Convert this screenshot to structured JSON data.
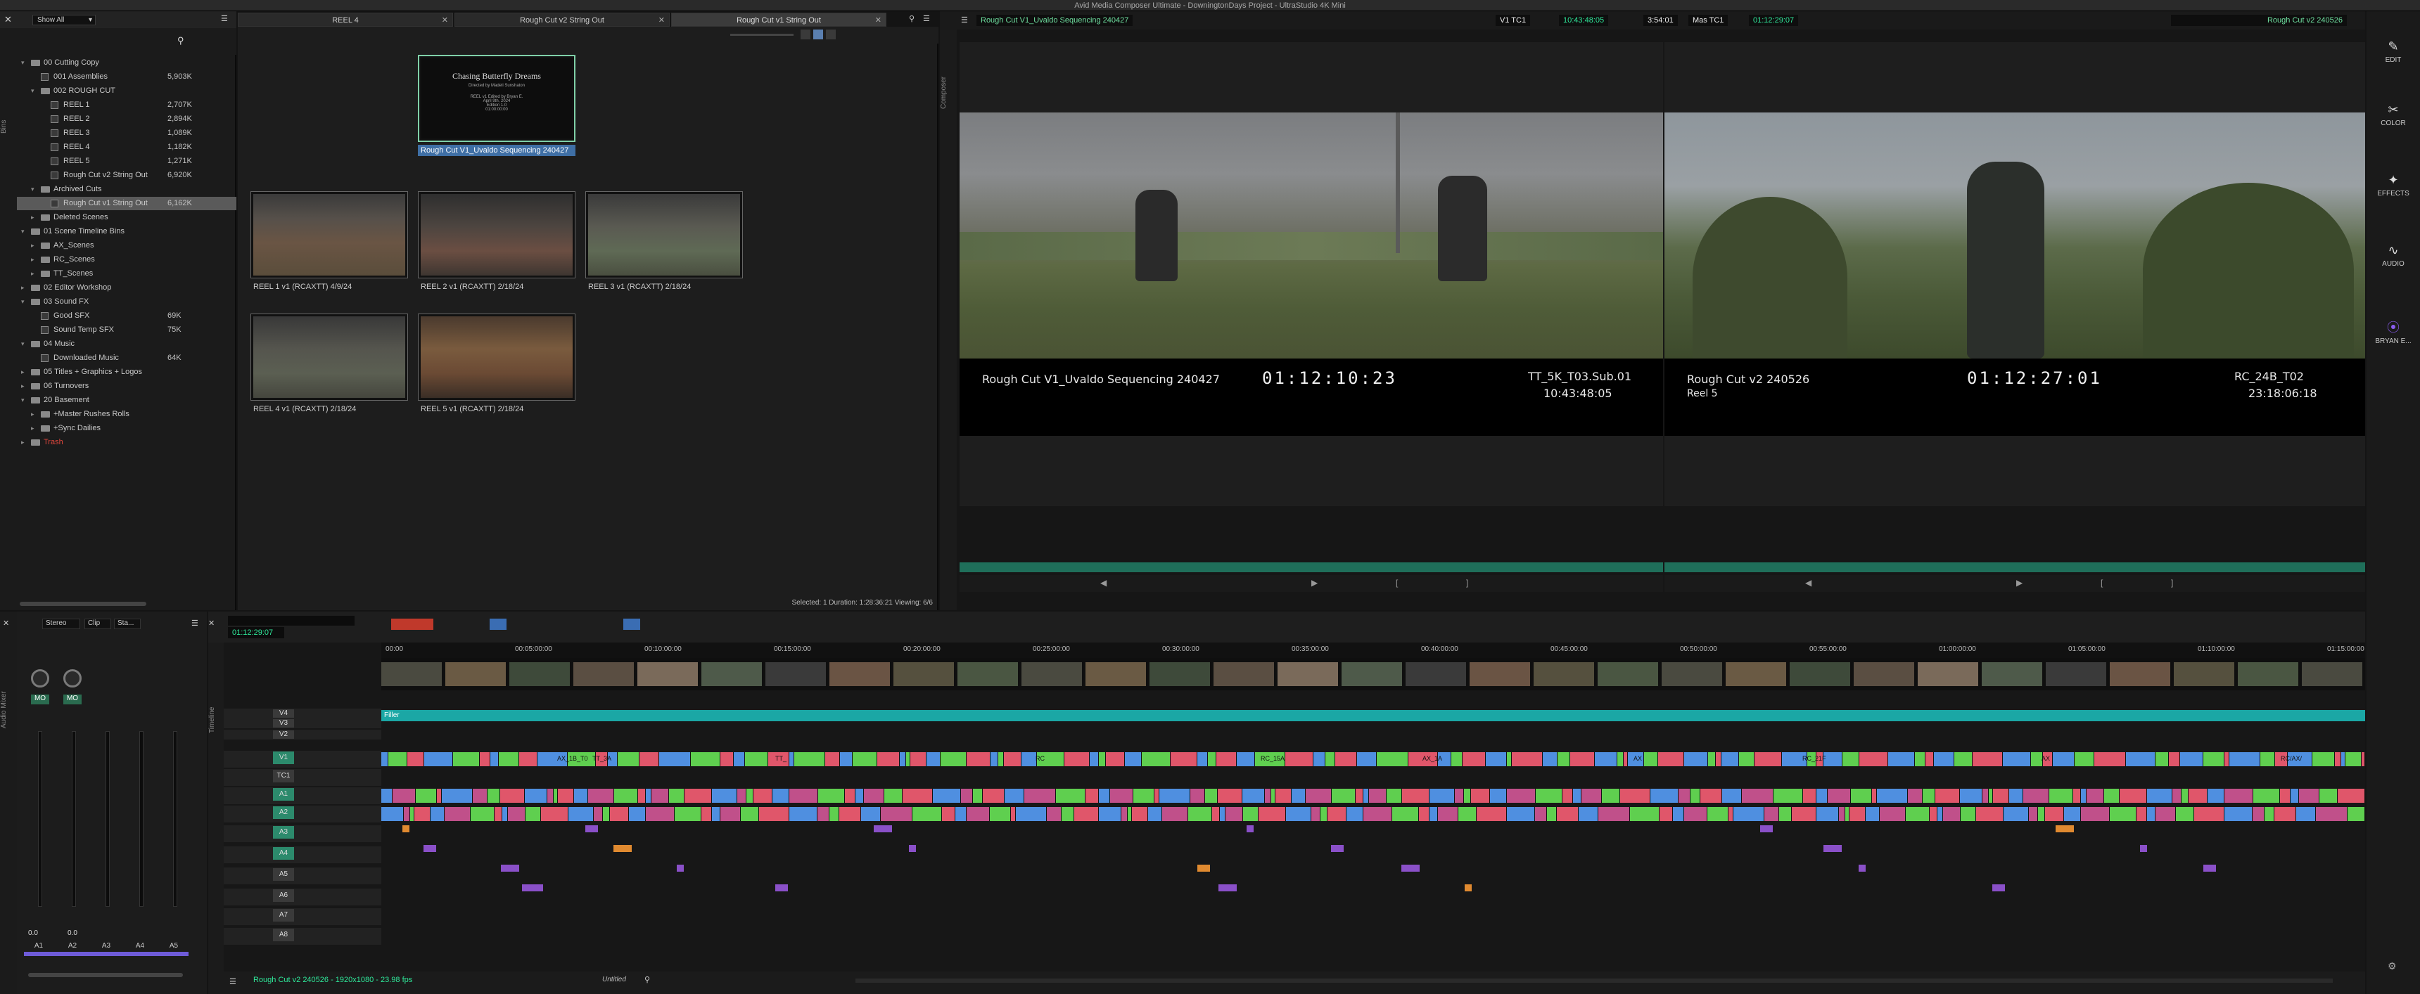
{
  "window": {
    "title": "Avid Media Composer Ultimate - DowningtonDays Project - UltraStudio 4K Mini"
  },
  "bins": {
    "show_all": "Show All",
    "tabs": [
      "Bins"
    ],
    "tree": [
      {
        "depth": 0,
        "open": true,
        "type": "folder",
        "label": "00 Cutting Copy",
        "size": ""
      },
      {
        "depth": 1,
        "open": false,
        "type": "bin",
        "label": "001 Assemblies",
        "size": "5,903K"
      },
      {
        "depth": 1,
        "open": true,
        "type": "folder",
        "label": "002 ROUGH CUT",
        "size": ""
      },
      {
        "depth": 2,
        "open": false,
        "type": "bin",
        "label": "REEL 1",
        "size": "2,707K"
      },
      {
        "depth": 2,
        "open": false,
        "type": "bin",
        "label": "REEL 2",
        "size": "2,894K"
      },
      {
        "depth": 2,
        "open": false,
        "type": "bin",
        "label": "REEL 3",
        "size": "1,089K"
      },
      {
        "depth": 2,
        "open": false,
        "type": "bin",
        "label": "REEL 4",
        "size": "1,182K"
      },
      {
        "depth": 2,
        "open": false,
        "type": "bin",
        "label": "REEL 5",
        "size": "1,271K"
      },
      {
        "depth": 2,
        "open": false,
        "type": "bin",
        "label": "Rough Cut v2 String Out",
        "size": "6,920K"
      },
      {
        "depth": 1,
        "open": true,
        "type": "folder",
        "label": "Archived Cuts",
        "size": ""
      },
      {
        "depth": 2,
        "open": false,
        "type": "bin",
        "label": "Rough Cut v1 String Out",
        "size": "6,162K",
        "selected": true
      },
      {
        "depth": 1,
        "open": false,
        "type": "folder",
        "label": "Deleted Scenes",
        "size": ""
      },
      {
        "depth": 0,
        "open": true,
        "type": "folder",
        "label": "01 Scene Timeline Bins",
        "size": ""
      },
      {
        "depth": 1,
        "open": false,
        "type": "folder",
        "label": "AX_Scenes",
        "size": ""
      },
      {
        "depth": 1,
        "open": false,
        "type": "folder",
        "label": "RC_Scenes",
        "size": ""
      },
      {
        "depth": 1,
        "open": false,
        "type": "folder",
        "label": "TT_Scenes",
        "size": ""
      },
      {
        "depth": 0,
        "open": false,
        "type": "folder",
        "label": "02 Editor Workshop",
        "size": ""
      },
      {
        "depth": 0,
        "open": true,
        "type": "folder",
        "label": "03 Sound FX",
        "size": ""
      },
      {
        "depth": 1,
        "open": false,
        "type": "bin",
        "label": "Good SFX",
        "size": "69K"
      },
      {
        "depth": 1,
        "open": false,
        "type": "bin",
        "label": "Sound Temp SFX",
        "size": "75K"
      },
      {
        "depth": 0,
        "open": true,
        "type": "folder",
        "label": "04 Music",
        "size": ""
      },
      {
        "depth": 1,
        "open": false,
        "type": "bin",
        "label": "Downloaded Music",
        "size": "64K"
      },
      {
        "depth": 0,
        "open": false,
        "type": "folder",
        "label": "05 Titles + Graphics + Logos",
        "size": ""
      },
      {
        "depth": 0,
        "open": false,
        "type": "folder",
        "label": "06 Turnovers",
        "size": ""
      },
      {
        "depth": 0,
        "open": true,
        "type": "folder",
        "label": "20 Basement",
        "size": ""
      },
      {
        "depth": 1,
        "open": false,
        "type": "folder",
        "label": "+Master Rushes Rolls",
        "size": ""
      },
      {
        "depth": 1,
        "open": false,
        "type": "folder",
        "label": "+Sync Dailies",
        "size": ""
      },
      {
        "depth": 0,
        "open": false,
        "type": "folder",
        "label": "Trash",
        "size": "",
        "trash": true
      }
    ]
  },
  "binview": {
    "tabs": [
      {
        "label": "REEL 4",
        "active": false
      },
      {
        "label": "Rough Cut v2 String Out",
        "active": false
      },
      {
        "label": "Rough Cut v1 String Out",
        "active": true
      }
    ],
    "items": [
      {
        "label": "Rough Cut V1_Uvaldo Sequencing 240427",
        "title_card": true,
        "selected": true
      },
      {
        "label": "REEL 1 v1 (RCAXTT) 4/9/24"
      },
      {
        "label": "REEL 2 v1 (RCAXTT) 2/18/24"
      },
      {
        "label": "REEL 3 v1 (RCAXTT) 2/18/24"
      },
      {
        "label": "REEL 4 v1 (RCAXTT) 2/18/24"
      },
      {
        "label": "REEL 5 v1 (RCAXTT) 2/18/24"
      }
    ],
    "title_card": {
      "title": "Chasing Butterfly Dreams",
      "line1": "Directed by Madeli Sunshaton",
      "line2": "REEL v1 Edited by Bryan E.",
      "line3": "April 9th, 2024",
      "line4": "Edition 1.0",
      "line5": "01:00:00:00"
    },
    "status": "Selected: 1  Duration: 1:28:36:21  Viewing: 6/6"
  },
  "composer": {
    "source_clip": "Rough Cut V1_Uvaldo Sequencing 240427",
    "record_clip": "Rough Cut v2 240526",
    "tc1_label": "V1  TC1",
    "tc1_value": "10:43:48:05",
    "duration": "3:54:01",
    "mas_label": "Mas  TC1",
    "mas_value": "01:12:29:07",
    "left": {
      "name": "Rough Cut V1_Uvaldo Sequencing 240427",
      "tc": "01:12:10:23",
      "clip": "TT_5K_T03.Sub.01",
      "src_tc": "10:43:48:05"
    },
    "right": {
      "name": "Rough Cut v2 240526",
      "reel": "Reel 5",
      "tc": "01:12:27:01",
      "clip": "RC_24B_T02",
      "src_tc": "23:18:06:18"
    }
  },
  "rail": [
    {
      "label": "EDIT",
      "icon": "pencil-icon"
    },
    {
      "label": "COLOR",
      "icon": "color-icon"
    },
    {
      "label": "EFFECTS",
      "icon": "effects-icon"
    },
    {
      "label": "AUDIO",
      "icon": "audio-icon"
    },
    {
      "label": "BRYAN E...",
      "icon": "user-icon"
    }
  ],
  "timeline": {
    "position": "01:12:29:07",
    "ruler": [
      "00:00",
      "00:05:00:00",
      "00:10:00:00",
      "00:15:00:00",
      "00:20:00:00",
      "00:25:00:00",
      "00:30:00:00",
      "00:35:00:00",
      "00:40:00:00",
      "00:45:00:00",
      "00:50:00:00",
      "00:55:00:00",
      "01:00:00:00",
      "01:05:00:00",
      "01:10:00:00",
      "01:15:00:00"
    ],
    "tracks": [
      "V4",
      "V3",
      "V2",
      "V1",
      "TC1",
      "A1",
      "A2",
      "A3",
      "A4",
      "A5",
      "A6",
      "A7",
      "A8"
    ],
    "filler": "Filler",
    "sequence_info": "Rough Cut v2 240526 - 1920x1080 - 23.98 fps",
    "untitled": "Untitled",
    "clip_labels": [
      "AX_1B_T0",
      "TT_3A",
      "TT_",
      "RC",
      "RC_15A",
      "AX_1A",
      "AX",
      "RC_21F",
      "AX",
      "RC/AX/"
    ]
  },
  "mixer": {
    "mode": "Stereo",
    "clip": "Clip",
    "sta": "Sta...",
    "channels": [
      "A1",
      "A2",
      "A3",
      "A4",
      "A5"
    ],
    "levels": [
      "0.0",
      "0.0"
    ],
    "mo": [
      "MO",
      "MO"
    ],
    "label": "Audio Mixer"
  },
  "colors": {
    "accent": "#2fe89a",
    "filler": "#1ba7a5",
    "v1_green": "#5fcf4f",
    "v1_red": "#e0566a",
    "v1_blue": "#4f8fe0",
    "audio_pink": "#c0508a",
    "audio_purple": "#8a50c8"
  }
}
